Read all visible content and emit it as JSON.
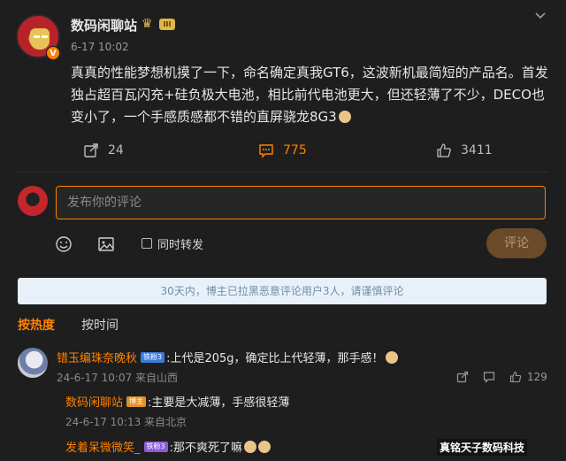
{
  "post": {
    "username": "数码闲聊站",
    "level": "III",
    "verified": "V",
    "time": "6-17 10:02",
    "text": "真真的性能梦想机摸了一下，命名确定真我GT6，这波新机最简短的产品名。首发独占超百瓦闪充+硅负极大电池，相比前代电池更大，但还轻薄了不少，DECO也变小了，一个手感质感都不错的直屏骁龙8G3",
    "reposts": "24",
    "comments": "775",
    "likes": "3411"
  },
  "composer": {
    "placeholder": "发布你的评论",
    "repost_label": "同时转发",
    "submit_label": "评论"
  },
  "notice": "30天内，博主已拉黑恶意评论用户3人，请谨慎评论",
  "sort": {
    "hot": "按热度",
    "time": "按时间"
  },
  "comments": [
    {
      "name": "错玉编珠奈晚秋",
      "badge": "铁粉3",
      "text": ":上代是205g，确定比上代轻薄，那手感！",
      "meta": "24-6-17 10:07 来自山西",
      "likes": "129"
    }
  ],
  "replies": [
    {
      "name": "数码闲聊站",
      "badge": "博主",
      "text": ":主要是大减薄，手感很轻薄",
      "meta": "24-6-17 10:13 来自北京"
    },
    {
      "name": "发着呆微微笑_",
      "badge": "铁粉3",
      "text": ":那不爽死了嘛"
    }
  ],
  "watermark": "真铭天子数码科技",
  "colors": {
    "accent": "#ff8200",
    "background": "#1e1e1e"
  }
}
